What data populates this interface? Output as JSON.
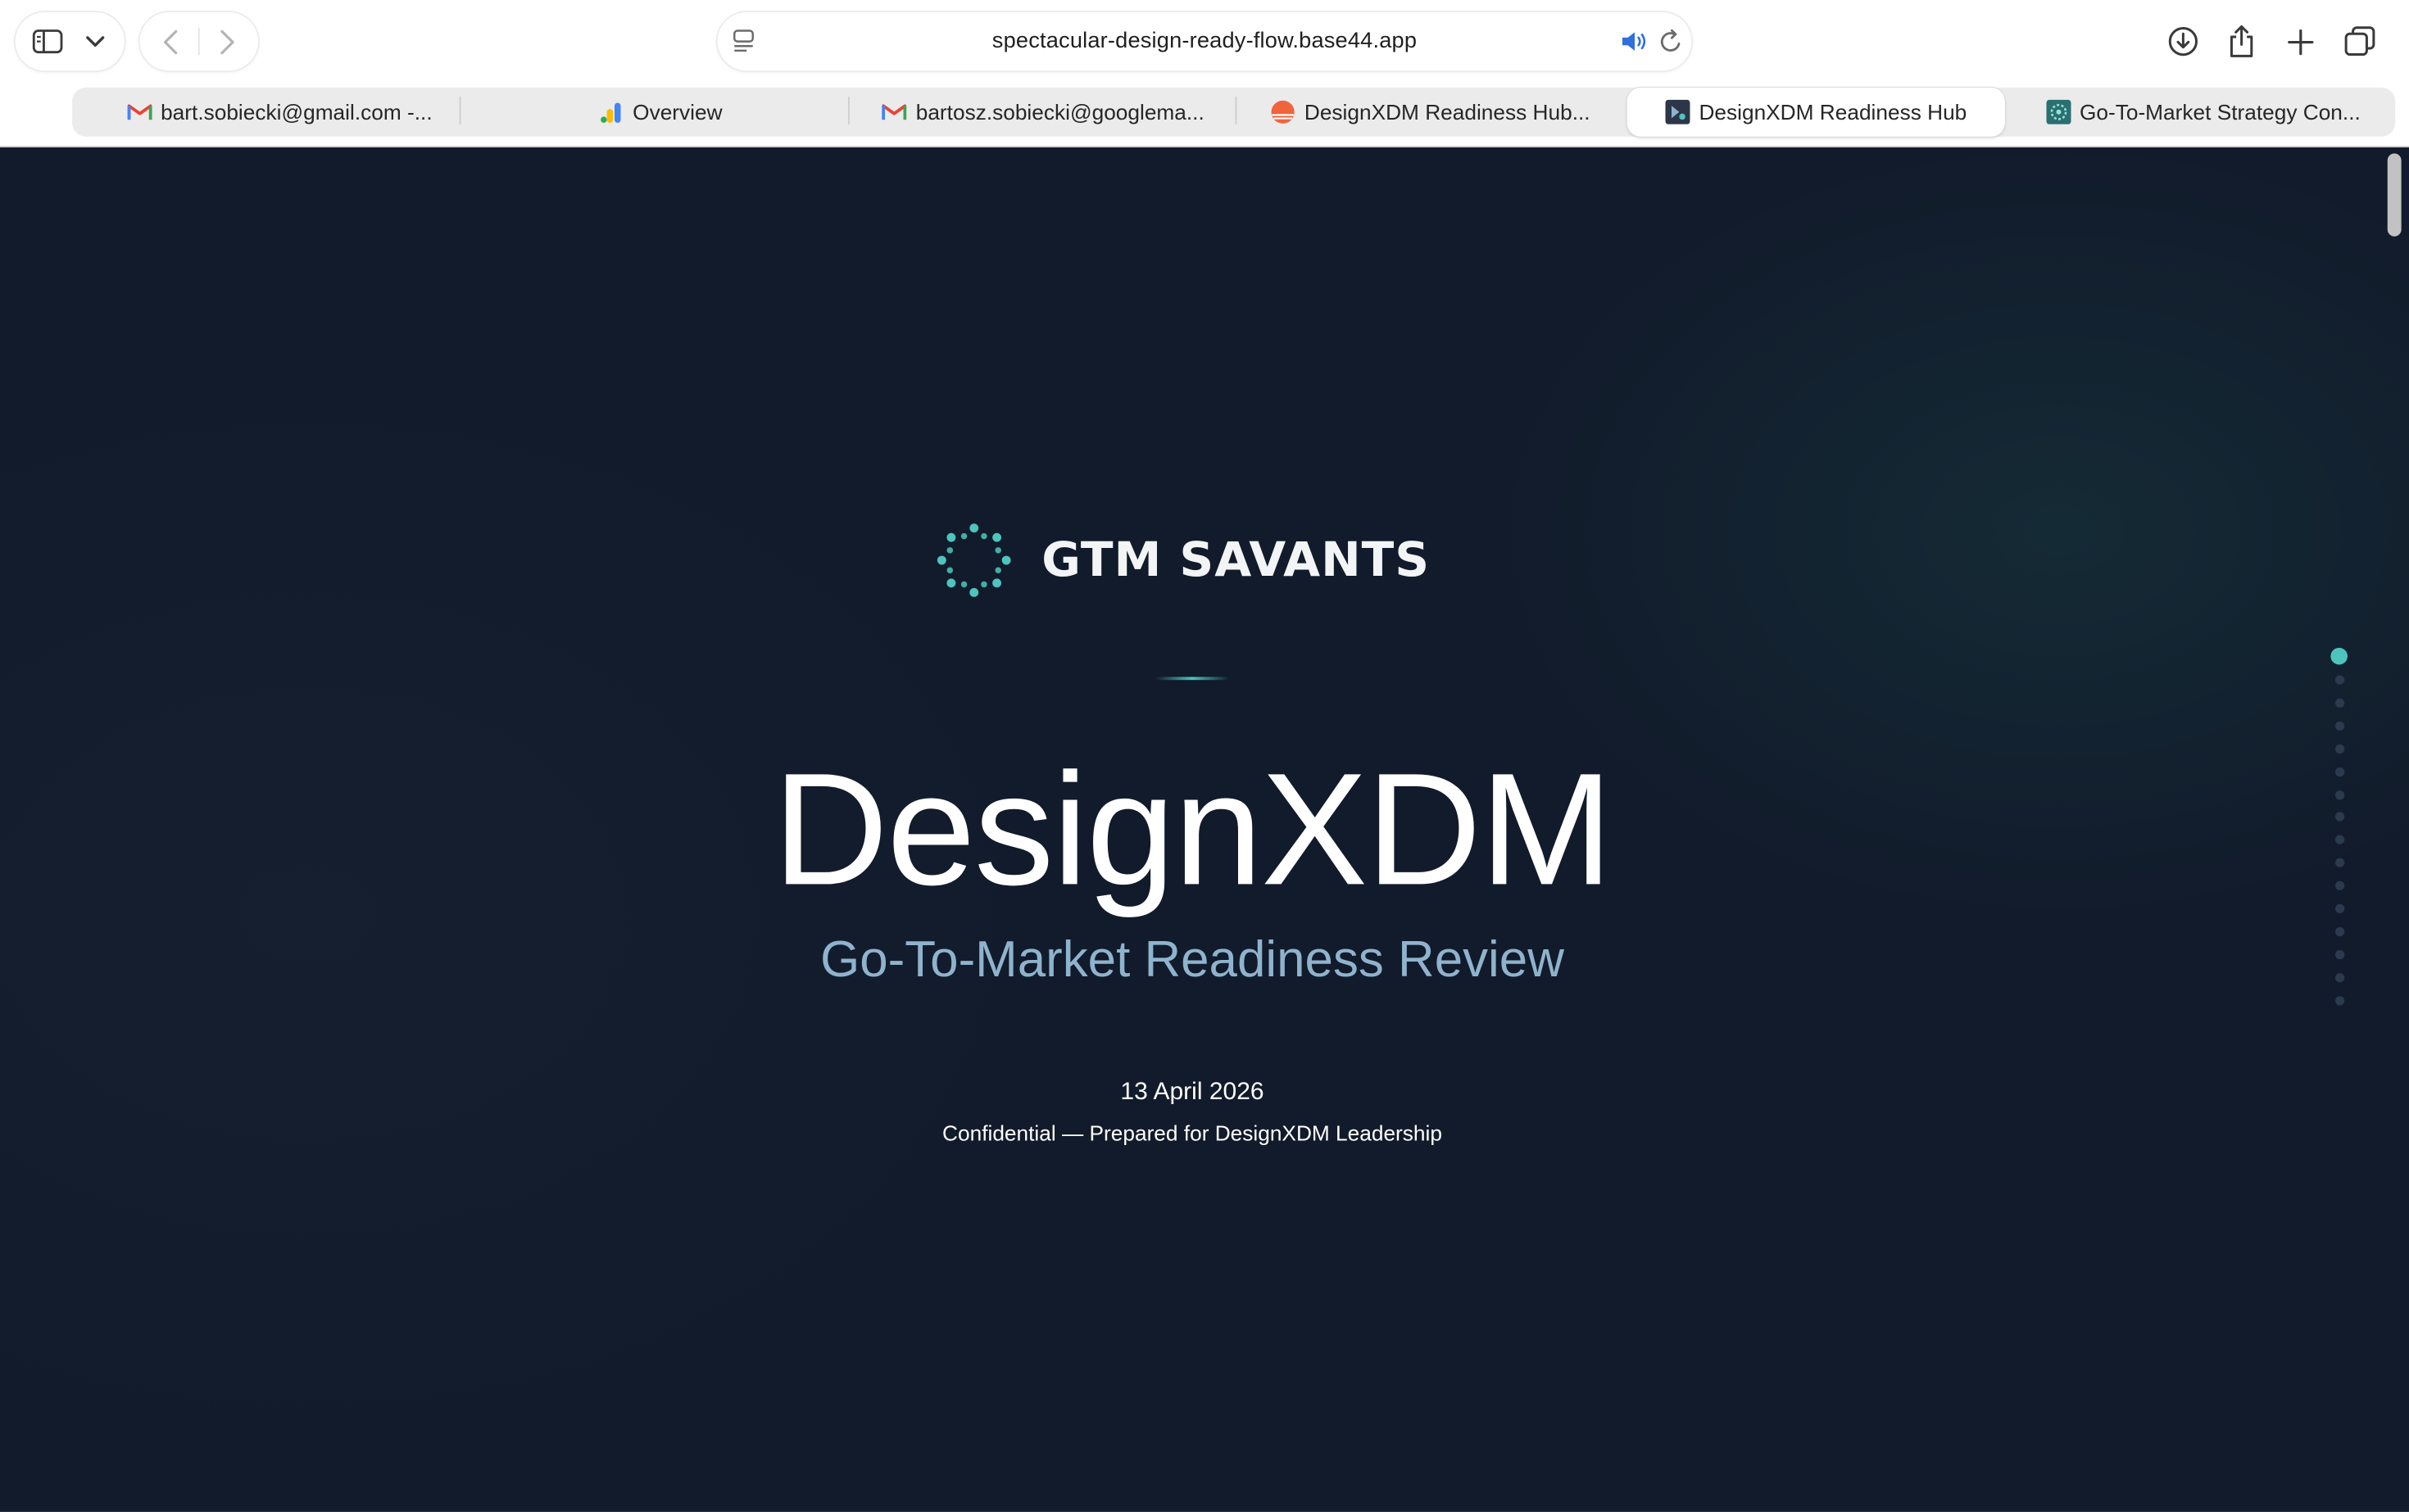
{
  "browser": {
    "url": "spectacular-design-ready-flow.base44.app",
    "tabs": [
      {
        "title": "bart.sobiecki@gmail.com -...",
        "favicon": "gmail-icon"
      },
      {
        "title": "Overview",
        "favicon": "analytics-icon"
      },
      {
        "title": "bartosz.sobiecki@googlema...",
        "favicon": "gmail-icon"
      },
      {
        "title": "DesignXDM Readiness Hub...",
        "favicon": "sunset-icon"
      },
      {
        "title": "DesignXDM Readiness Hub",
        "favicon": "app-icon",
        "active": true
      },
      {
        "title": "Go-To-Market Strategy Con...",
        "favicon": "pattern-icon"
      }
    ],
    "toolbar_icons": [
      "sidebar-icon",
      "chevron-down-icon",
      "back-icon",
      "forward-icon",
      "reader-icon",
      "audio-icon",
      "reload-icon",
      "download-icon",
      "share-icon",
      "new-tab-icon",
      "tab-overview-icon",
      "chatgpt-icon"
    ]
  },
  "page": {
    "brand_name": "GTM SAVANTS",
    "title": "DesignXDM",
    "subtitle": "Go-To-Market Readiness Review",
    "date": "13 April 2026",
    "confidential": "Confidential — Prepared for DesignXDM Leadership",
    "slide_nav": {
      "total": 16,
      "current": 1
    }
  },
  "colors": {
    "background": "#121b2b",
    "accent": "#4ec4be",
    "subtitle": "#8fb3cc",
    "text": "#ffffff"
  }
}
